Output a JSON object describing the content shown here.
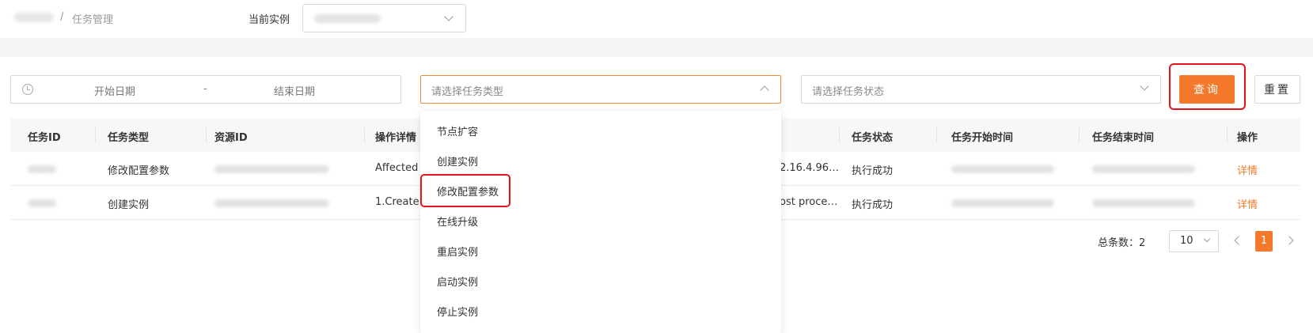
{
  "header": {
    "breadcrumb_separator": "/",
    "breadcrumb_current": "任务管理",
    "instance_label": "当前实例"
  },
  "filters": {
    "date_start_placeholder": "开始日期",
    "date_separator": "-",
    "date_end_placeholder": "结束日期",
    "task_type_placeholder": "请选择任务类型",
    "task_status_placeholder": "请选择任务状态",
    "query_label": "查询",
    "reset_label": "重置"
  },
  "table": {
    "columns": [
      "任务ID",
      "任务类型",
      "资源ID",
      "操作详情",
      "任务状态",
      "任务开始时间",
      "任务结束时间",
      "操作"
    ],
    "rows": [
      {
        "task_type": "修改配置参数",
        "detail_start": "Affected N",
        "detail_end": "2.16.4.96…",
        "status": "执行成功",
        "action": "详情"
      },
      {
        "task_type": "创建实例",
        "detail_start": "1.Create",
        "detail_end": "ost proce…",
        "status": "执行成功",
        "action": "详情"
      }
    ]
  },
  "dropdown": {
    "items": [
      "节点扩容",
      "创建实例",
      "修改配置参数",
      "在线升级",
      "重启实例",
      "启动实例",
      "停止实例"
    ]
  },
  "pagination": {
    "total_label": "总条数：2",
    "page_size": "10",
    "current_page": "1"
  },
  "colors": {
    "accent": "#f5792a",
    "highlight": "#e8121c"
  }
}
